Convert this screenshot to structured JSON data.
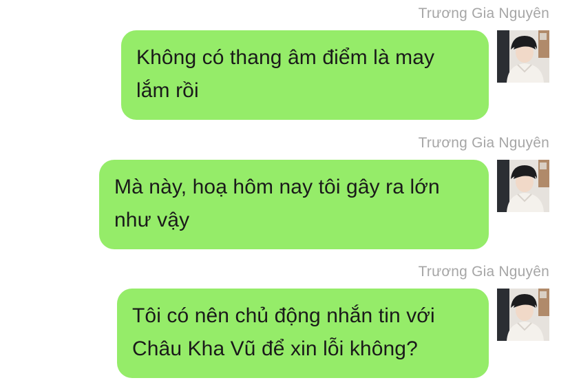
{
  "messages": [
    {
      "sender": "Trương Gia Nguyên",
      "text": "Không có thang âm điểm là may lắm rồi",
      "avatar_icon": "user-avatar-icon"
    },
    {
      "sender": "Trương Gia Nguyên",
      "text": "Mà này, hoạ hôm nay tôi gây ra lớn như vậy",
      "avatar_icon": "user-avatar-icon"
    },
    {
      "sender": "Trương Gia Nguyên",
      "text": "Tôi có nên chủ động nhắn tin với Châu Kha Vũ để xin lỗi không?",
      "avatar_icon": "user-avatar-icon"
    }
  ],
  "colors": {
    "bubble": "#95ec69",
    "sender_name": "#a6a6a6",
    "background": "#ffffff"
  }
}
